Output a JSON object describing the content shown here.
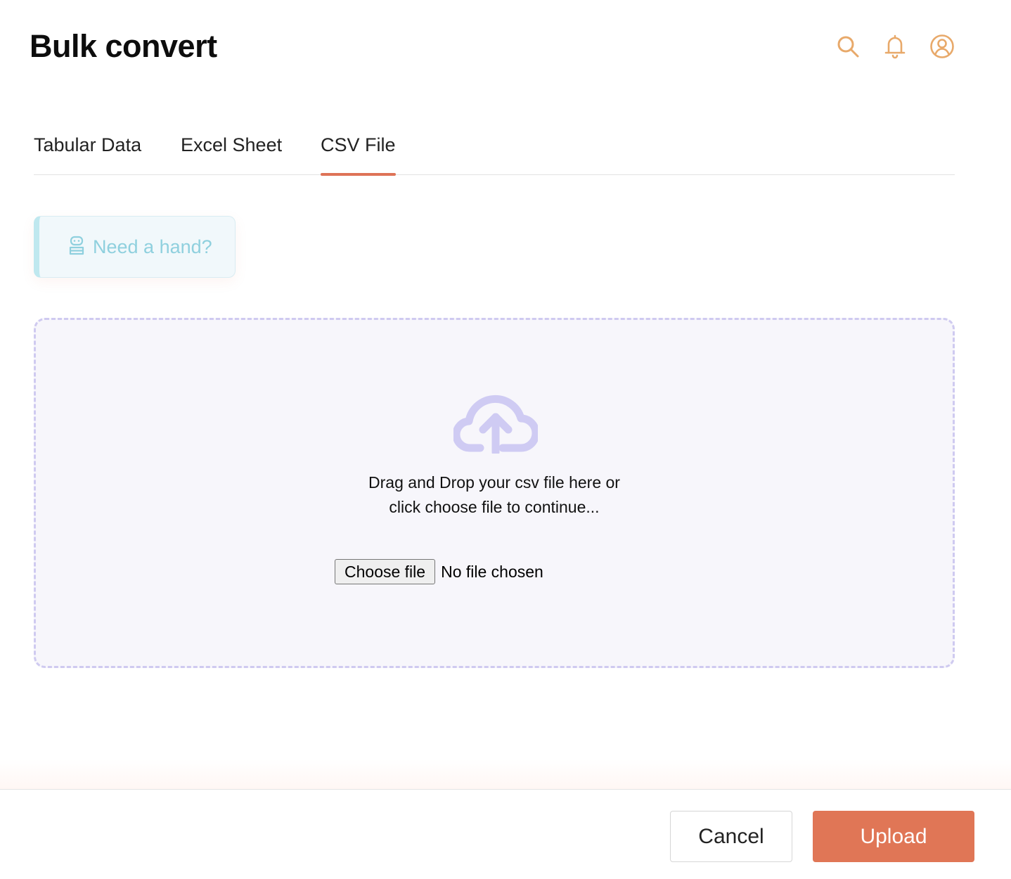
{
  "header": {
    "title": "Bulk convert",
    "icons": [
      "search-icon",
      "bell-icon",
      "user-profile-icon"
    ]
  },
  "tabs": [
    {
      "label": "Tabular Data",
      "active": false
    },
    {
      "label": "Excel Sheet",
      "active": false
    },
    {
      "label": "CSV File",
      "active": true
    }
  ],
  "help": {
    "label": "Need a hand?",
    "icon": "robot-icon"
  },
  "dropzone": {
    "icon": "cloud-upload-icon",
    "line1": "Drag and Drop your csv file here or",
    "line2": "click choose file to continue...",
    "choose_label": "Choose file",
    "file_status": "No file chosen"
  },
  "footer": {
    "cancel_label": "Cancel",
    "upload_label": "Upload"
  },
  "colors": {
    "accent": "#de7357",
    "header_icon": "#e8a96a",
    "help_text": "#8fd0de",
    "dropzone_border": "#cfcaf0",
    "cloud": "#cfcbf3"
  }
}
